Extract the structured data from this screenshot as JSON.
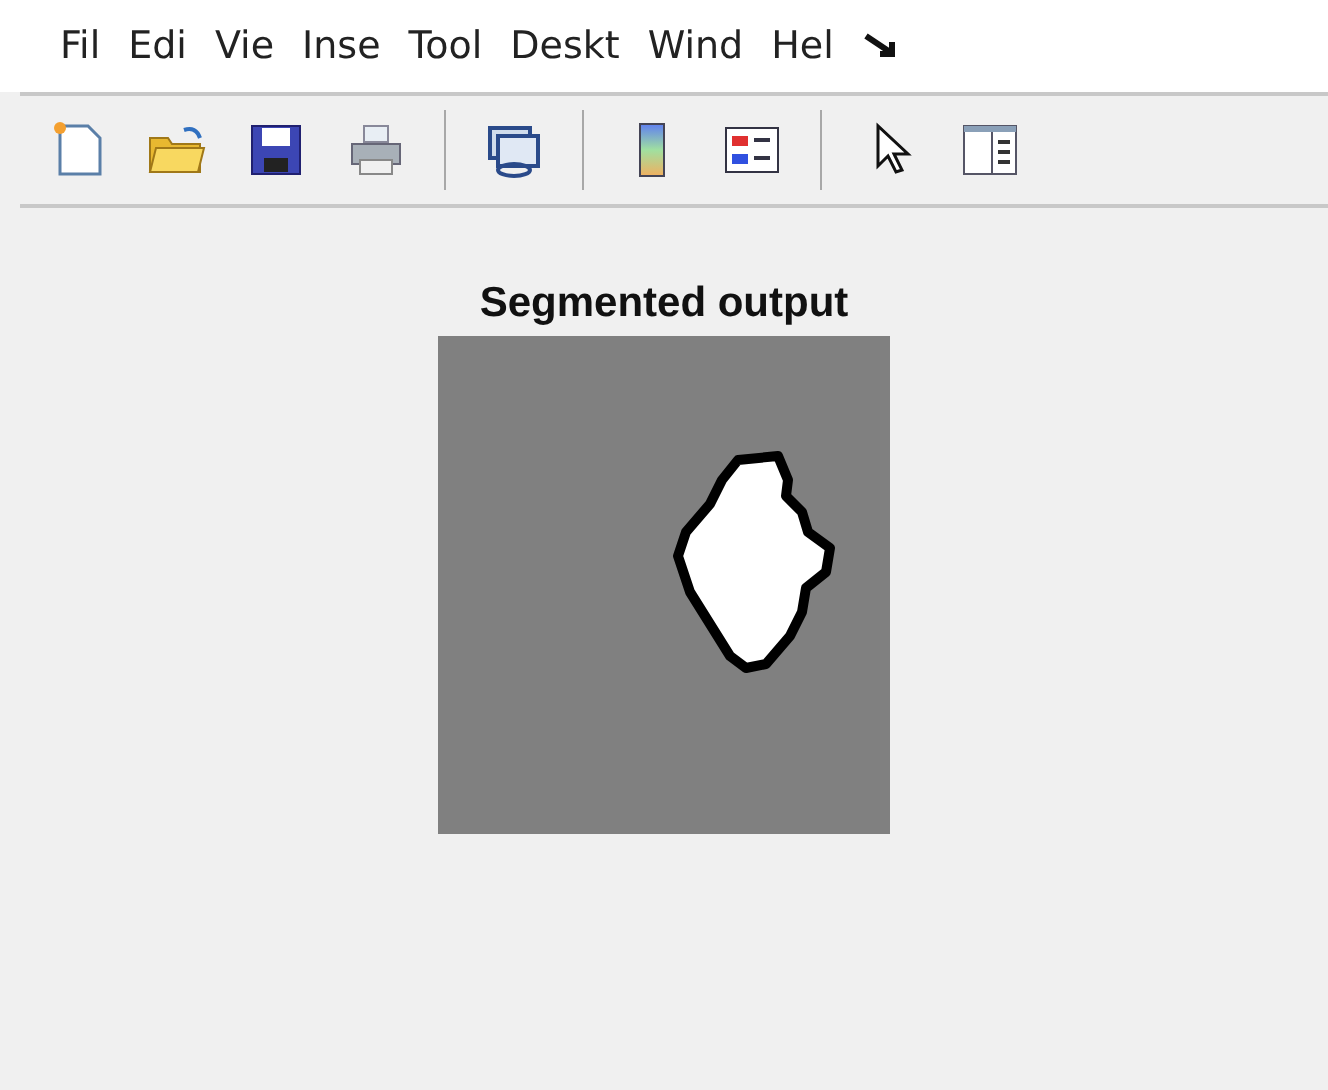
{
  "menu_bar": {
    "items": [
      "Fil",
      "Edi",
      "Vie",
      "Inse",
      "Tool",
      "Deskt",
      "Wind",
      "Hel"
    ]
  },
  "toolbar": {
    "buttons": [
      {
        "kind": "new"
      },
      {
        "kind": "open"
      },
      {
        "kind": "save"
      },
      {
        "kind": "print"
      },
      {
        "kind": "separator"
      },
      {
        "kind": "link"
      },
      {
        "kind": "separator"
      },
      {
        "kind": "colorbar"
      },
      {
        "kind": "legend"
      },
      {
        "kind": "separator"
      },
      {
        "kind": "pointer"
      },
      {
        "kind": "panel"
      }
    ]
  },
  "axes": {
    "title": "Segmented output"
  }
}
